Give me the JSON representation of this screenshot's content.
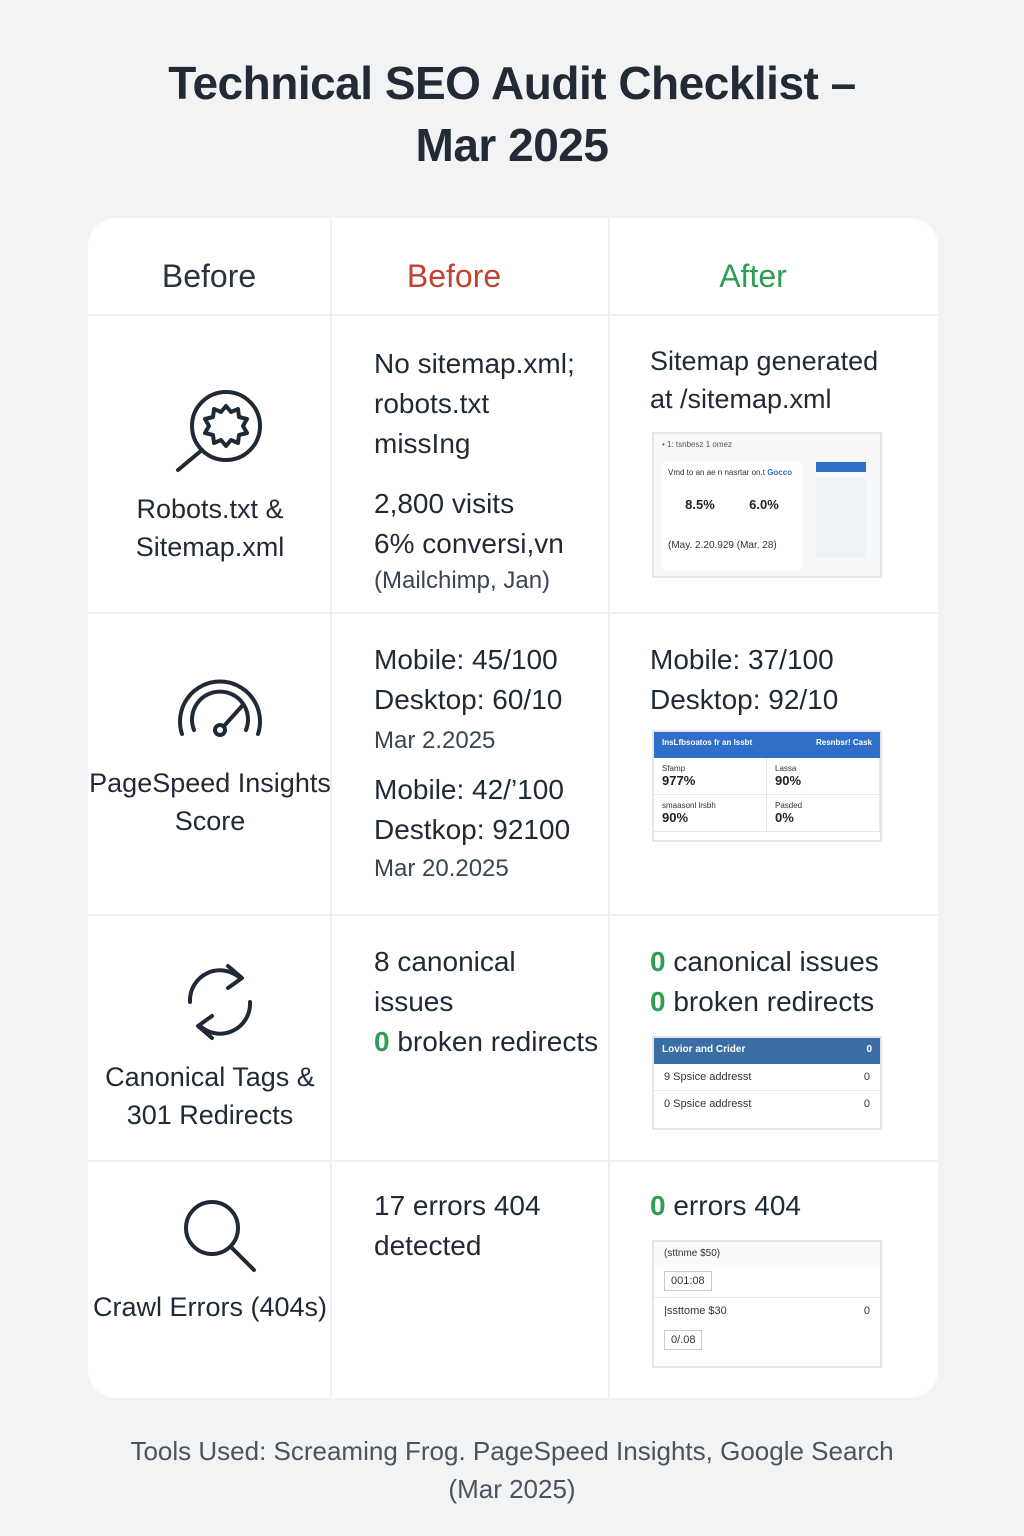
{
  "title": {
    "line1": "Technical SEO Audit Checklist –",
    "line2": "Mar 2025"
  },
  "colors": {
    "before": "#c0432f",
    "after": "#2f9e55",
    "text": "#1f2a36"
  },
  "headers": {
    "col1": "Before",
    "col2": "Before",
    "col3": "After"
  },
  "rows": [
    {
      "icon": "gear-search-icon",
      "label": "Robots.txt & Sitemap.xml",
      "before": [
        "No sitemap.xml;",
        "robots.txt",
        "missIng"
      ],
      "before_extra": [
        "2,800 visits",
        "6% conversi,vn"
      ],
      "before_note": "(Mailchimp, Jan)",
      "after": [
        "Sitemap generated",
        "at /sitemap.xml"
      ],
      "shot": {
        "top": "• 1: tsnbesz 1 omez",
        "heading": "Vmd to an ae n nasrtar on.t",
        "chip": "Gocco",
        "stat1": "8.5%",
        "stat2": "6.0%",
        "date": "(May. 2.20.929 (Mar. 28)"
      }
    },
    {
      "icon": "gauge-icon",
      "label": "PageSpeed Insights Score",
      "before": [
        "Mobile: 45/100",
        "Desktop: 60/10"
      ],
      "before_date": "Mar 2.2025",
      "before2": [
        "Mobile: 42/’100",
        "Destkop: 92100"
      ],
      "before2_date": "Mar 20.2025",
      "after": [
        "Mobile: 37/100",
        "Desktop: 92/10"
      ],
      "shot": {
        "left": "InsLfbsoatos fr an lssbt",
        "right": "Resnbsr! Cask",
        "a_label": "Sfamp",
        "a_val": "977%",
        "b_label": "Lassa",
        "b_val": "90%",
        "c_label": "smaasonl lrsbh",
        "c_val": "90%",
        "d_label": "Pasded",
        "d_val": "0%"
      }
    },
    {
      "icon": "sync-arrows-icon",
      "label": "Canonical Tags & 301 Redirects",
      "before_line1": "8 canonical",
      "before_line2": "issues",
      "before_num": "0",
      "before_rest": " broken redirects",
      "after_num1": "0",
      "after_rest1": " canonical issues",
      "after_num2": "0",
      "after_rest2": " broken redirects",
      "shot": {
        "head": "Lovior and Crider",
        "head_val": "0",
        "r1": "9 Spsice addresst",
        "r1_val": "0",
        "r2": "0 Spsice addresst",
        "r2_val": "0"
      }
    },
    {
      "icon": "magnifier-icon",
      "label": "Crawl Errors (404s)",
      "before": [
        "17 errors 404",
        "detected"
      ],
      "after_num": "0",
      "after_rest": " errors 404",
      "shot": {
        "r1": "(sttnme $50)",
        "box1": "001:08",
        "r2": "|ssttome $30",
        "r2_val": "0",
        "box2": "0/.08"
      }
    }
  ],
  "footer": {
    "line1": "Tools Used: Screaming Frog. PageSpeed Insights, Google Search",
    "line2": "(Mar 2025)"
  }
}
